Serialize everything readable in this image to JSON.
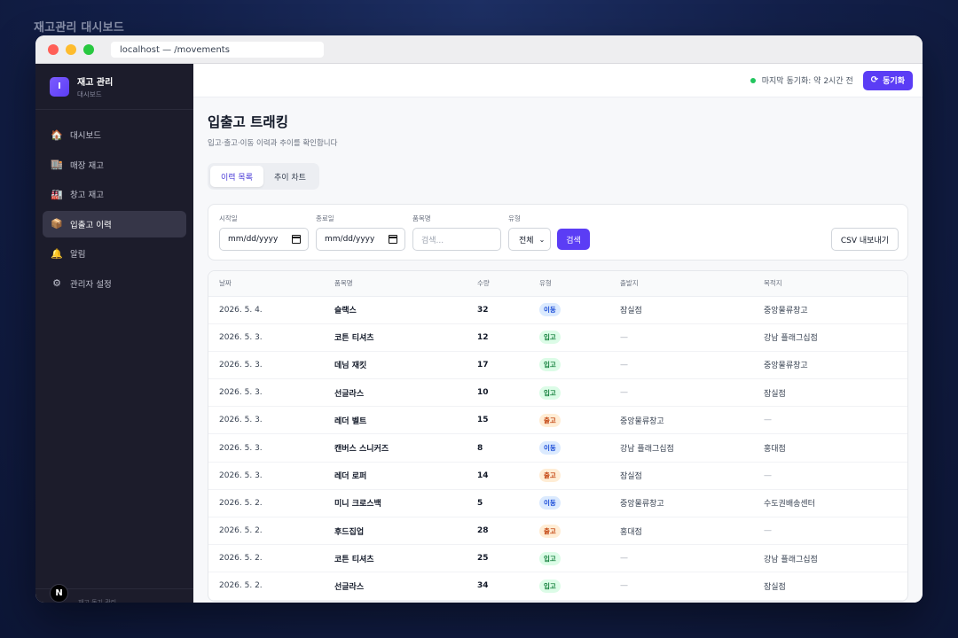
{
  "caption": "재고관리 대시보드",
  "browser": {
    "url": "localhost — /movements"
  },
  "brand": {
    "logo": "I",
    "title": "재고 관리",
    "subtitle": "대시보드"
  },
  "sidebar": {
    "items": [
      {
        "label": "대시보드",
        "icon": "house-icon",
        "glyph": "🏠"
      },
      {
        "label": "매장 재고",
        "icon": "store-icon",
        "glyph": "🏬"
      },
      {
        "label": "창고 재고",
        "icon": "warehouse-icon",
        "glyph": "🏭"
      },
      {
        "label": "입출고 이력",
        "icon": "package-icon",
        "glyph": "📦"
      },
      {
        "label": "알림",
        "icon": "bell-icon",
        "glyph": "🔔"
      },
      {
        "label": "관리자 설정",
        "icon": "gear-icon",
        "glyph": "⚙"
      }
    ],
    "active_index": 3,
    "footer": "재고 동기 관리",
    "next_badge": "N"
  },
  "topbar": {
    "sync_status": "마지막 동기화: 약 2시간 전",
    "sync_button": "동기화"
  },
  "page": {
    "title": "입출고 트래킹",
    "subtitle": "입고·출고·이동 이력과 추이를 확인합니다"
  },
  "tabs": [
    {
      "label": "이력 목록",
      "active": true
    },
    {
      "label": "추이 차트",
      "active": false
    }
  ],
  "filters": {
    "start_label": "시작일",
    "start_value": "mm/dd/yyyy",
    "end_label": "종료일",
    "end_value": "mm/dd/yyyy",
    "item_label": "품목명",
    "item_placeholder": "검색...",
    "type_label": "유형",
    "type_value": "전체",
    "search_button": "검색",
    "csv_button": "CSV 내보내기"
  },
  "table": {
    "headers": [
      "날짜",
      "품목명",
      "수량",
      "유형",
      "출발지",
      "목적지"
    ],
    "rows": [
      {
        "date": "2026. 5. 4.",
        "item": "슬랙스",
        "qty": "32",
        "type": "이동",
        "kind": "move",
        "from": "잠실점",
        "to": "중앙물류창고"
      },
      {
        "date": "2026. 5. 3.",
        "item": "코튼 티셔츠",
        "qty": "12",
        "type": "입고",
        "kind": "in",
        "from": "—",
        "to": "강남 플래그십점"
      },
      {
        "date": "2026. 5. 3.",
        "item": "데님 재킷",
        "qty": "17",
        "type": "입고",
        "kind": "in",
        "from": "—",
        "to": "중앙물류창고"
      },
      {
        "date": "2026. 5. 3.",
        "item": "선글라스",
        "qty": "10",
        "type": "입고",
        "kind": "in",
        "from": "—",
        "to": "잠실점"
      },
      {
        "date": "2026. 5. 3.",
        "item": "레더 벨트",
        "qty": "15",
        "type": "출고",
        "kind": "out",
        "from": "중앙물류창고",
        "to": "—"
      },
      {
        "date": "2026. 5. 3.",
        "item": "캔버스 스니커즈",
        "qty": "8",
        "type": "이동",
        "kind": "move",
        "from": "강남 플래그십점",
        "to": "홍대점"
      },
      {
        "date": "2026. 5. 3.",
        "item": "레더 로퍼",
        "qty": "14",
        "type": "출고",
        "kind": "out",
        "from": "잠실점",
        "to": "—"
      },
      {
        "date": "2026. 5. 2.",
        "item": "미니 크로스백",
        "qty": "5",
        "type": "이동",
        "kind": "move",
        "from": "중앙물류창고",
        "to": "수도권배송센터"
      },
      {
        "date": "2026. 5. 2.",
        "item": "후드집업",
        "qty": "28",
        "type": "출고",
        "kind": "out",
        "from": "홍대점",
        "to": "—"
      },
      {
        "date": "2026. 5. 2.",
        "item": "코튼 티셔츠",
        "qty": "25",
        "type": "입고",
        "kind": "in",
        "from": "—",
        "to": "강남 플래그십점"
      },
      {
        "date": "2026. 5. 2.",
        "item": "선글라스",
        "qty": "34",
        "type": "입고",
        "kind": "in",
        "from": "—",
        "to": "잠실점"
      }
    ]
  }
}
